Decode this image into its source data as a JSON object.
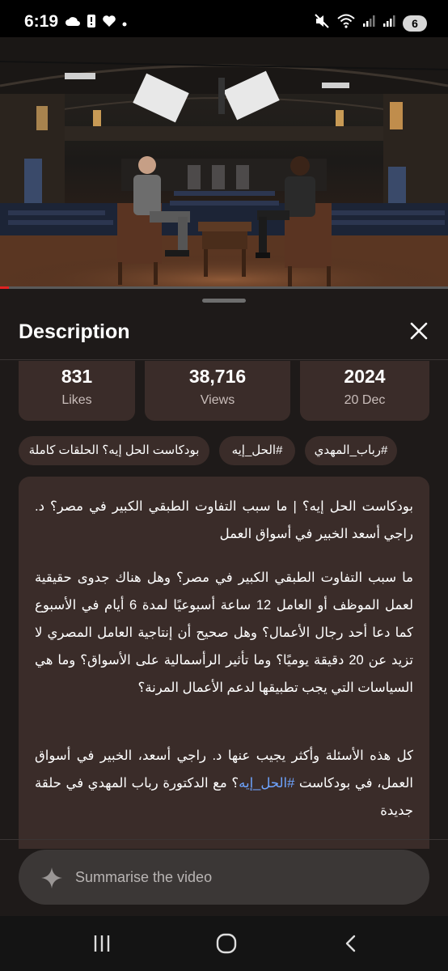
{
  "status_bar": {
    "time": "6:19",
    "battery_level": "6",
    "left_icons": [
      "cloud-icon",
      "phone-alert-icon",
      "heart-icon",
      "dot-icon"
    ],
    "right_icons": [
      "mute-icon",
      "wifi-icon",
      "signal-icon",
      "signal-icon"
    ]
  },
  "video": {
    "progress_fraction": 0.02,
    "accent": "#e22222"
  },
  "sheet": {
    "title": "Description",
    "close_icon": "close-icon"
  },
  "stats": [
    {
      "value": "831",
      "label": "Likes"
    },
    {
      "value": "38,716",
      "label": "Views"
    },
    {
      "value": "2024",
      "label": "20 Dec"
    }
  ],
  "tags": [
    "بودكاست الحل إيه؟ الحلقات كاملة",
    "#الحل_إيه",
    "#رباب_المهدي"
  ],
  "description": {
    "title": "بودكاست الحل إيه؟ | ما سبب التفاوت الطبقي الكبير في مصر؟ د. راجي أسعد الخبير في أسواق العمل",
    "body": "ما سبب التفاوت الطبقي الكبير في مصر؟ وهل هناك جدوى حقيقية لعمل الموظف أو العامل 12 ساعة أسبوعيًا لمدة 6 أيام في الأسبوع كما دعا أحد رجال الأعمال؟ وهل صحيح أن إنتاجية العامل المصري لا تزيد عن 20 دقيقة يوميًا؟ وما تأثير الرأسمالية على الأسواق؟ وما هي السياسات التي يجب تطبيقها لدعم الأعمال المرنة؟",
    "closing_before": "كل هذه الأسئلة وأكثر يجيب عنها د. راجي أسعد، الخبير في أسواق العمل، في بودكاست ",
    "closing_hashtag": "#الحل_إيه",
    "closing_after": "؟ مع الدكتورة رباب المهدي في حلقة جديدة"
  },
  "summarise": {
    "label": "Summarise the video",
    "icon": "sparkle-icon"
  },
  "navbar": {
    "icons": [
      "recent-apps-icon",
      "home-icon",
      "back-icon"
    ]
  }
}
